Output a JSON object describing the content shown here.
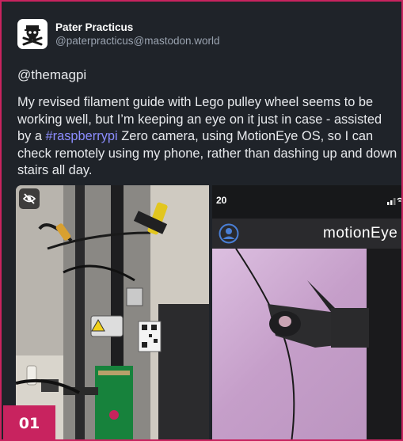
{
  "post": {
    "display_name": "Pater Practicus",
    "handle": "@paterpracticus@mastodon.world",
    "mention": "@themagpi",
    "text_before_tag": "My revised filament guide with Lego pulley wheel seems to be working well, but I’m keeping an eye on it just in case - assisted by a ",
    "hashtag": "#raspberrypi",
    "text_after_tag": " Zero camera, using MotionEye OS, so I can check remotely using my phone, rather than dashing up and down stairs all day."
  },
  "media": {
    "hide_icon": "eye-slash-icon",
    "phone_time": "20",
    "app_title": "motionEye"
  },
  "badge": {
    "label": "01"
  },
  "colors": {
    "background": "#1f2329",
    "frame_border": "#c8235f",
    "hashtag": "#8c8dff",
    "handle": "#9aa3b0",
    "badge": "#c8235f",
    "app_accent": "#4a7fd6"
  }
}
